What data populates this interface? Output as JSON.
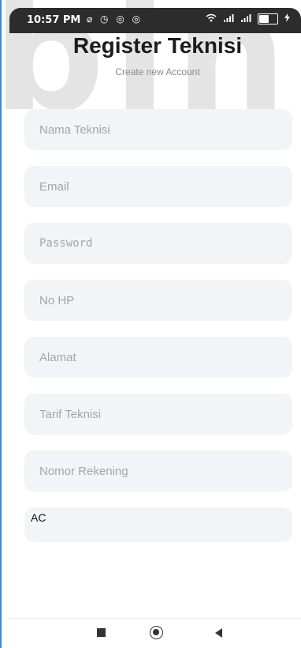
{
  "status_bar": {
    "time": "10:57 PM",
    "left_icons": "⌀ ◷ ◎ ◎",
    "battery_level": 0.6,
    "icons": [
      "wifi-icon",
      "signal-icon",
      "battery-icon",
      "charging-icon"
    ]
  },
  "header": {
    "title": "Register Teknisi",
    "subtitle": "Create new Account"
  },
  "form": {
    "fields": [
      {
        "name": "nama-teknisi-field",
        "placeholder": "Nama Teknisi",
        "value": ""
      },
      {
        "name": "email-field",
        "placeholder": "Email",
        "value": ""
      },
      {
        "name": "password-field",
        "placeholder": "Password",
        "value": ""
      },
      {
        "name": "no-hp-field",
        "placeholder": "No HP",
        "value": ""
      },
      {
        "name": "alamat-field",
        "placeholder": "Alamat",
        "value": ""
      },
      {
        "name": "tarif-teknisi-field",
        "placeholder": "Tarif Teknisi",
        "value": ""
      },
      {
        "name": "nomor-rekening-field",
        "placeholder": "Nomor Rekening",
        "value": ""
      },
      {
        "name": "keahlian-field",
        "placeholder": "",
        "value": "AC"
      }
    ]
  },
  "nav_bar": {
    "icons": [
      "recents-square-icon",
      "home-circle-icon",
      "back-triangle-icon"
    ]
  },
  "colors": {
    "field_background": "#f3f4f7",
    "placeholder": "#a3a5ab",
    "title": "#1c1c1c",
    "status_bar": "#2c2c2c"
  }
}
